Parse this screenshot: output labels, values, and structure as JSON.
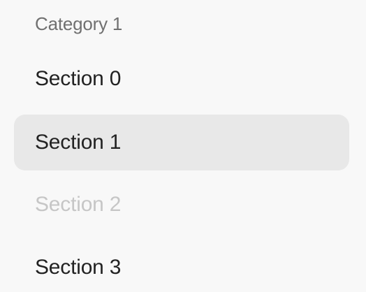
{
  "category": {
    "label": "Category 1"
  },
  "items": [
    {
      "label": "Section 0",
      "state": "default"
    },
    {
      "label": "Section 1",
      "state": "selected"
    },
    {
      "label": "Section 2",
      "state": "disabled"
    },
    {
      "label": "Section 3",
      "state": "default"
    }
  ],
  "colors": {
    "background": "#f8f8f8",
    "selected_background": "#e8e8e8",
    "text": "#222222",
    "heading_text": "#707070",
    "disabled_text": "#c6c6c6"
  }
}
